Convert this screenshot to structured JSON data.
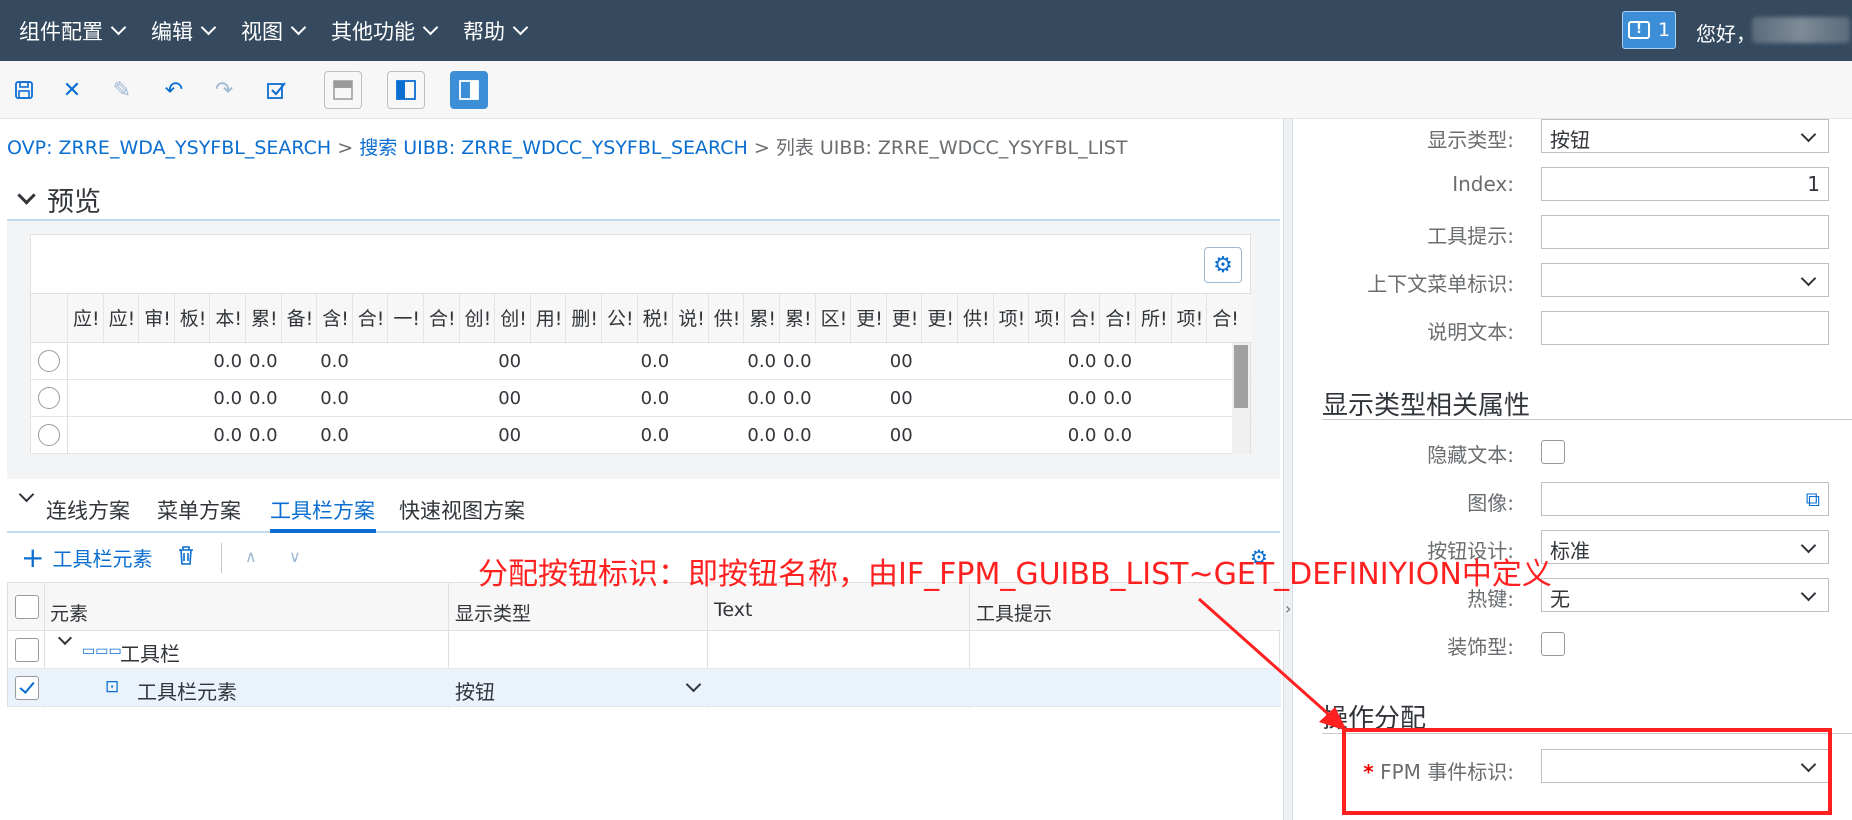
{
  "menubar": {
    "items": [
      "组件配置",
      "编辑",
      "视图",
      "其他功能",
      "帮助"
    ],
    "notification_count": "1",
    "greeting": "您好，"
  },
  "toolbar": {
    "buttons": [
      "save-icon",
      "close-icon",
      "edit-icon",
      "undo-icon",
      "redo-icon",
      "check-icon",
      "layout-top-icon",
      "layout-left-icon",
      "layout-right-icon"
    ]
  },
  "breadcrumb": {
    "ovp": "OVP: ZRRE_WDA_YSYFBL_SEARCH",
    "sep1": " > ",
    "search": "搜索 UIBB: ZRRE_WDCC_YSYFBL_SEARCH",
    "sep2": " > ",
    "current": "列表 UIBB: ZRRE_WDCC_YSYFBL_LIST"
  },
  "preview": {
    "title": "预览",
    "columns": [
      "应!",
      "应!",
      "审!",
      "板!",
      "本!",
      "累!",
      "备!",
      "含!",
      "合!",
      "一!",
      "合!",
      "创!",
      "创!",
      "用!",
      "删!",
      "公!",
      "税!",
      "说!",
      "供!",
      "累!",
      "累!",
      "区!",
      "更!",
      "更!",
      "更!",
      "供!",
      "项!",
      "项!",
      "合!",
      "合!",
      "所!",
      "项!",
      "合!"
    ],
    "row_cells": [
      {
        "col": 4,
        "text": "0.0"
      },
      {
        "col": 5,
        "text": "0.0"
      },
      {
        "col": 7,
        "text": "0.0"
      },
      {
        "col": 12,
        "text": "00"
      },
      {
        "col": 16,
        "text": "0.0"
      },
      {
        "col": 19,
        "text": "0.0"
      },
      {
        "col": 20,
        "text": "0.0"
      },
      {
        "col": 23,
        "text": "00"
      },
      {
        "col": 28,
        "text": "0.0"
      },
      {
        "col": 29,
        "text": "0.0"
      }
    ]
  },
  "tabs": {
    "items": [
      "连线方案",
      "菜单方案",
      "工具栏方案",
      "快速视图方案"
    ],
    "active": "工具栏方案"
  },
  "tab_toolbar": {
    "add_label": "工具栏元素"
  },
  "grid": {
    "headers": [
      "元素",
      "显示类型",
      "Text",
      "工具提示"
    ],
    "rows": [
      {
        "element": "工具栏",
        "type": "",
        "checked": false
      },
      {
        "element": "工具栏元素",
        "type": "按钮",
        "checked": true
      }
    ]
  },
  "right_panel": {
    "fields": [
      {
        "label": "显示类型:",
        "value": "按钮",
        "kind": "dropdown"
      },
      {
        "label": "Index:",
        "value": "1",
        "kind": "number"
      },
      {
        "label": "工具提示:",
        "value": "",
        "kind": "text"
      },
      {
        "label": "上下文菜单标识:",
        "value": "",
        "kind": "dropdown"
      },
      {
        "label": "说明文本:",
        "value": "",
        "kind": "text"
      }
    ],
    "section2_title": "显示类型相关属性",
    "fields2": [
      {
        "label": "隐藏文本:",
        "kind": "checkbox"
      },
      {
        "label": "图像:",
        "value": "",
        "kind": "picker"
      },
      {
        "label": "按钮设计:",
        "value": "标准",
        "kind": "dropdown"
      },
      {
        "label": "热键:",
        "value": "无",
        "kind": "dropdown"
      },
      {
        "label": "装饰型:",
        "kind": "checkbox"
      }
    ],
    "section3_title": "操作分配",
    "fpm_label": "FPM 事件标识:",
    "required_mark": "*"
  },
  "annotation": {
    "text": "分配按钮标识：即按钮名称，由IF_FPM_GUIBB_LIST~GET_DEFINIYION中定义",
    "color": "#ff2020"
  }
}
